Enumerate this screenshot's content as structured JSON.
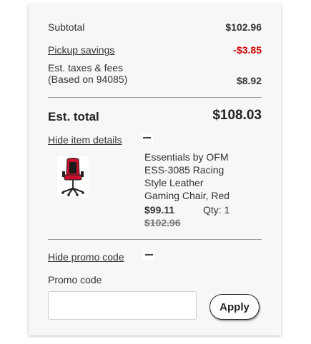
{
  "summary": {
    "subtotal_label": "Subtotal",
    "subtotal_value": "$102.96",
    "pickup_label": "Pickup savings",
    "pickup_value": "-$3.85",
    "taxes_label_line1": "Est. taxes & fees",
    "taxes_label_line2": "(Based on 94085)",
    "taxes_value": "$8.92",
    "total_label": "Est. total",
    "total_value": "$108.03"
  },
  "item_details": {
    "toggle_label": "Hide item details",
    "item": {
      "name_lines": [
        "Essentials by OFM",
        "ESS-3085 Racing",
        "Style Leather",
        "Gaming Chair, Red"
      ],
      "price": "$99.11",
      "qty": "Qty: 1",
      "original_price": "$102.96",
      "thumbnail": "red-gaming-chair-image"
    }
  },
  "promo": {
    "toggle_label": "Hide promo code",
    "field_label": "Promo code",
    "input_value": "",
    "input_placeholder": "",
    "apply_label": "Apply"
  },
  "colors": {
    "savings_red": "#cc0000",
    "card_bg": "#f7f7f7"
  }
}
